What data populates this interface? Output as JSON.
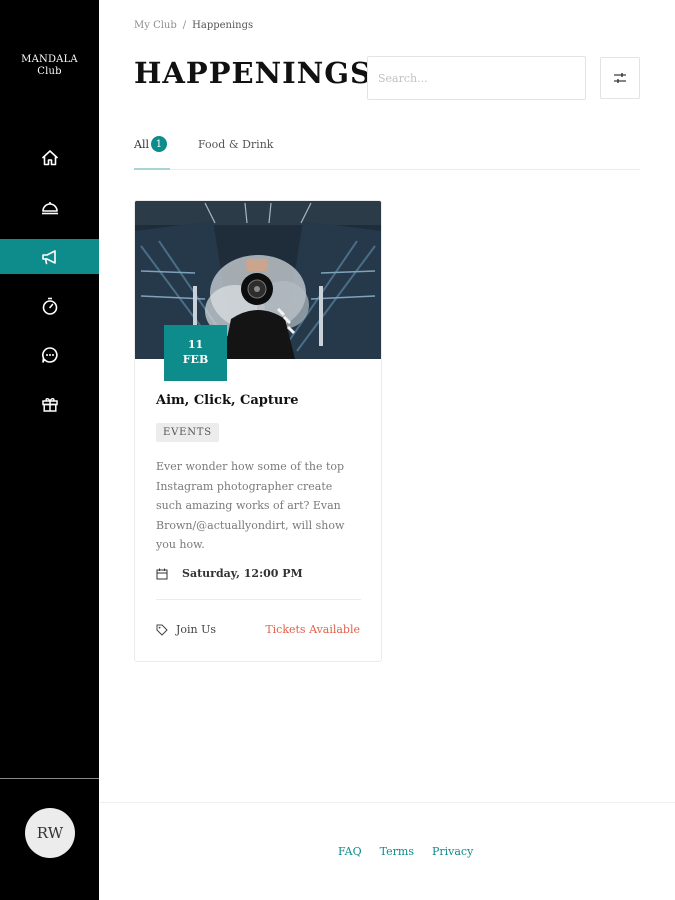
{
  "brand": {
    "line1": "MANDALA",
    "line2": "Club"
  },
  "sidebar": {
    "items": [
      {
        "icon": "home-icon",
        "active": false
      },
      {
        "icon": "dining-cloche-icon",
        "active": false
      },
      {
        "icon": "megaphone-icon",
        "active": true
      },
      {
        "icon": "stopwatch-icon",
        "active": false
      },
      {
        "icon": "chat-bubble-icon",
        "active": false
      },
      {
        "icon": "gift-icon",
        "active": false
      }
    ],
    "user_initials": "RW"
  },
  "breadcrumb": {
    "parent": "My Club",
    "separator": "/",
    "current": "Happenings"
  },
  "header": {
    "title": "HAPPENINGS"
  },
  "search": {
    "placeholder": "Search...",
    "value": ""
  },
  "tabs": [
    {
      "label": "All",
      "count": "1",
      "active": true
    },
    {
      "label": "Food & Drink",
      "active": false
    }
  ],
  "events": [
    {
      "date_day": "11",
      "date_month": "FEB",
      "title": "Aim, Click, Capture",
      "tag": "EVENTS",
      "description": "Ever wonder how some of the top Instagram photographer create such amazing works of art? Evan Brown/@actuallyondirt, will show you how.",
      "when": "Saturday, 12:00 PM",
      "join_label": "Join Us",
      "tickets_label": "Tickets Available"
    }
  ],
  "footer": {
    "links": [
      "FAQ",
      "Terms",
      "Privacy"
    ]
  },
  "colors": {
    "accent": "#0e8c8c",
    "tickets": "#e2614b",
    "sidebar_bg": "#000000"
  }
}
